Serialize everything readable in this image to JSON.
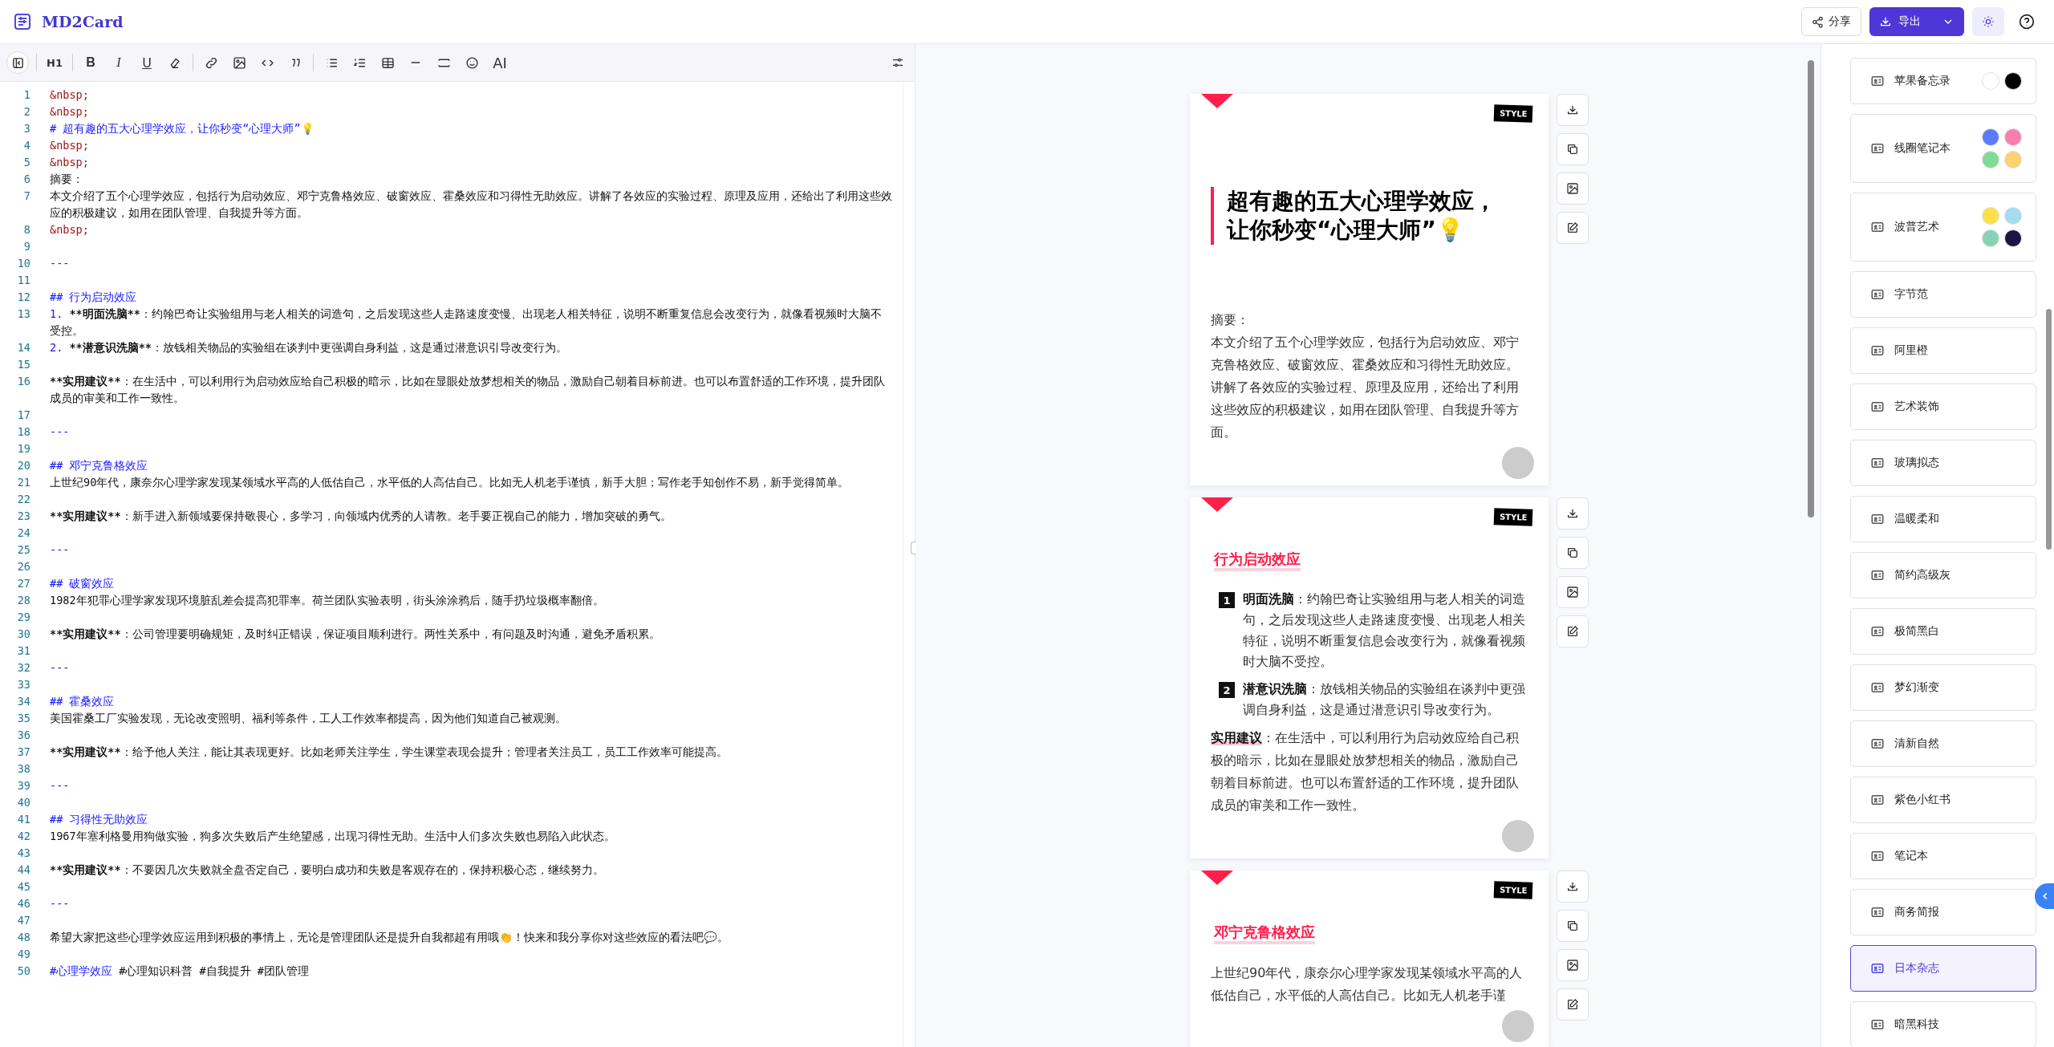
{
  "header": {
    "app_name": "MD2Card",
    "share_label": "分享",
    "export_label": "导出"
  },
  "toolbar": [
    {
      "kind": "sidebar-toggle"
    },
    {
      "kind": "sep"
    },
    {
      "kind": "heading",
      "label": "H1"
    },
    {
      "kind": "sep"
    },
    {
      "kind": "bold",
      "label": "B"
    },
    {
      "kind": "italic",
      "label": "I"
    },
    {
      "kind": "underline",
      "label": "U"
    },
    {
      "kind": "eraser"
    },
    {
      "kind": "sep"
    },
    {
      "kind": "link"
    },
    {
      "kind": "image"
    },
    {
      "kind": "code"
    },
    {
      "kind": "quote"
    },
    {
      "kind": "sep"
    },
    {
      "kind": "ul"
    },
    {
      "kind": "ol"
    },
    {
      "kind": "table"
    },
    {
      "kind": "hr"
    },
    {
      "kind": "block"
    },
    {
      "kind": "emoji"
    },
    {
      "kind": "ai",
      "label": "AI"
    }
  ],
  "editor_lines": [
    {
      "num": "1",
      "parts": [
        {
          "kind": "entity",
          "text": "&nbsp;"
        }
      ]
    },
    {
      "num": "2",
      "parts": [
        {
          "kind": "entity",
          "text": "&nbsp;"
        }
      ]
    },
    {
      "num": "3",
      "parts": [
        {
          "kind": "markup",
          "text": "# 超有趣的五大心理学效应，让你秒变“心理大师”💡"
        }
      ]
    },
    {
      "num": "4",
      "parts": [
        {
          "kind": "entity",
          "text": "&nbsp;"
        }
      ]
    },
    {
      "num": "5",
      "parts": [
        {
          "kind": "entity",
          "text": "&nbsp;"
        }
      ]
    },
    {
      "num": "6",
      "parts": [
        {
          "kind": "plain",
          "text": "摘要："
        }
      ]
    },
    {
      "num": "7",
      "parts": [
        {
          "kind": "plain",
          "text": "本文介绍了五个心理学效应，包括行为启动效应、邓宁克鲁格效应、破窗效应、霍桑效应和习得性无助效应。讲解了各效应的实验过程、原理及应用，还给出了利用这些效应的积极建议，如用在团队管理、自我提升等方面。"
        }
      ]
    },
    {
      "num": "8",
      "parts": [
        {
          "kind": "entity",
          "text": "&nbsp;"
        }
      ]
    },
    {
      "num": "9"
    },
    {
      "num": "10",
      "parts": [
        {
          "kind": "markup",
          "text": "---"
        }
      ]
    },
    {
      "num": "11"
    },
    {
      "num": "12",
      "parts": [
        {
          "kind": "markup",
          "text": "## 行为启动效应"
        }
      ]
    },
    {
      "num": "13",
      "parts": [
        {
          "kind": "markup",
          "text": "1. "
        },
        {
          "kind": "strong",
          "text": "**明面洗脑**"
        },
        {
          "kind": "plain",
          "text": "：约翰巴奇让实验组用与老人相关的词造句，之后发现这些人走路速度变慢、出现老人相关特征，说明不断重复信息会改变行为，就像看视频时大脑不受控。"
        }
      ]
    },
    {
      "num": "14",
      "parts": [
        {
          "kind": "markup",
          "text": "2. "
        },
        {
          "kind": "strong",
          "text": "**潜意识洗脑**"
        },
        {
          "kind": "plain",
          "text": "：放钱相关物品的实验组在谈判中更强调自身利益，这是通过潜意识引导改变行为。"
        }
      ]
    },
    {
      "num": "15"
    },
    {
      "num": "16",
      "parts": [
        {
          "kind": "strong",
          "text": "**实用建议**"
        },
        {
          "kind": "plain",
          "text": "：在生活中，可以利用行为启动效应给自己积极的暗示，比如在显眼处放梦想相关的物品，激励自己朝着目标前进。也可以布置舒适的工作环境，提升团队成员的审美和工作一致性。"
        }
      ]
    },
    {
      "num": "17"
    },
    {
      "num": "18",
      "parts": [
        {
          "kind": "markup",
          "text": "---"
        }
      ]
    },
    {
      "num": "19"
    },
    {
      "num": "20",
      "parts": [
        {
          "kind": "markup",
          "text": "## 邓宁克鲁格效应"
        }
      ]
    },
    {
      "num": "21",
      "parts": [
        {
          "kind": "plain",
          "text": "上世纪90年代，康奈尔心理学家发现某领域水平高的人低估自己，水平低的人高估自己。比如无人机老手谨慎，新手大胆；写作老手知创作不易，新手觉得简单。"
        }
      ]
    },
    {
      "num": "22"
    },
    {
      "num": "23",
      "parts": [
        {
          "kind": "strong",
          "text": "**实用建议**"
        },
        {
          "kind": "plain",
          "text": "：新手进入新领域要保持敬畏心，多学习，向领域内优秀的人请教。老手要正视自己的能力，增加突破的勇气。"
        }
      ]
    },
    {
      "num": "24"
    },
    {
      "num": "25",
      "parts": [
        {
          "kind": "markup",
          "text": "---"
        }
      ]
    },
    {
      "num": "26"
    },
    {
      "num": "27",
      "parts": [
        {
          "kind": "markup",
          "text": "## 破窗效应"
        }
      ]
    },
    {
      "num": "28",
      "parts": [
        {
          "kind": "plain",
          "text": "1982年犯罪心理学家发现环境脏乱差会提高犯罪率。荷兰团队实验表明，街头涂涂鸦后，随手扔垃圾概率翻倍。"
        }
      ]
    },
    {
      "num": "29"
    },
    {
      "num": "30",
      "parts": [
        {
          "kind": "strong",
          "text": "**实用建议**"
        },
        {
          "kind": "plain",
          "text": "：公司管理要明确规矩，及时纠正错误，保证项目顺利进行。两性关系中，有问题及时沟通，避免矛盾积累。"
        }
      ]
    },
    {
      "num": "31"
    },
    {
      "num": "32",
      "parts": [
        {
          "kind": "markup",
          "text": "---"
        }
      ]
    },
    {
      "num": "33"
    },
    {
      "num": "34",
      "parts": [
        {
          "kind": "markup",
          "text": "## 霍桑效应"
        }
      ]
    },
    {
      "num": "35",
      "parts": [
        {
          "kind": "plain",
          "text": "美国霍桑工厂实验发现，无论改变照明、福利等条件，工人工作效率都提高，因为他们知道自己被观测。"
        }
      ]
    },
    {
      "num": "36"
    },
    {
      "num": "37",
      "parts": [
        {
          "kind": "strong",
          "text": "**实用建议**"
        },
        {
          "kind": "plain",
          "text": "：给予他人关注，能让其表现更好。比如老师关注学生，学生课堂表现会提升；管理者关注员工，员工工作效率可能提高。"
        }
      ]
    },
    {
      "num": "38"
    },
    {
      "num": "39",
      "parts": [
        {
          "kind": "markup",
          "text": "---"
        }
      ]
    },
    {
      "num": "40"
    },
    {
      "num": "41",
      "parts": [
        {
          "kind": "markup",
          "text": "## 习得性无助效应"
        }
      ]
    },
    {
      "num": "42",
      "parts": [
        {
          "kind": "plain",
          "text": "1967年塞利格曼用狗做实验，狗多次失败后产生绝望感，出现习得性无助。生活中人们多次失败也易陷入此状态。"
        }
      ]
    },
    {
      "num": "43"
    },
    {
      "num": "44",
      "parts": [
        {
          "kind": "strong",
          "text": "**实用建议**"
        },
        {
          "kind": "plain",
          "text": "：不要因几次失败就全盘否定自己，要明白成功和失败是客观存在的，保持积极心态，继续努力。"
        }
      ]
    },
    {
      "num": "45"
    },
    {
      "num": "46",
      "parts": [
        {
          "kind": "markup",
          "text": "---"
        }
      ]
    },
    {
      "num": "47"
    },
    {
      "num": "48",
      "parts": [
        {
          "kind": "plain",
          "text": "希望大家把这些心理学效应运用到积极的事情上，无论是管理团队还是提升自我都超有用哦👏！快来和我分享你对这些效应的看法吧💬。"
        }
      ]
    },
    {
      "num": "49"
    },
    {
      "num": "50",
      "parts": [
        {
          "kind": "markup",
          "text": "#心理学效应"
        },
        {
          "kind": "plain",
          "text": " #心理知识科普 #自我提升 #团队管理"
        }
      ]
    }
  ],
  "cards": [
    {
      "badge": "STYLE",
      "blocks": [
        {
          "kind": "title",
          "text": "超有趣的五大心理学效应，让你秒变“心理大师”💡"
        },
        {
          "kind": "para",
          "text": "摘要："
        },
        {
          "kind": "para",
          "text": "本文介绍了五个心理学效应，包括行为启动效应、邓宁克鲁格效应、破窗效应、霍桑效应和习得性无助效应。讲解了各效应的实验过程、原理及应用，还给出了利用这些效应的积极建议，如用在团队管理、自我提升等方面。"
        }
      ]
    },
    {
      "badge": "STYLE",
      "blocks": [
        {
          "kind": "heading",
          "text": "行为启动效应"
        },
        {
          "kind": "item",
          "number": "1",
          "lead": "明面洗脑",
          "text": "：约翰巴奇让实验组用与老人相关的词造句，之后发现这些人走路速度变慢、出现老人相关特征，说明不断重复信息会改变行为，就像看视频时大脑不受控。"
        },
        {
          "kind": "item",
          "number": "2",
          "lead": "潜意识洗脑",
          "text": "：放钱相关物品的实验组在谈判中更强调自身利益，这是通过潜意识引导改变行为。"
        },
        {
          "kind": "tip",
          "lead": "实用建议",
          "text": "：在生活中，可以利用行为启动效应给自己积极的暗示，比如在显眼处放梦想相关的物品，激励自己朝着目标前进。也可以布置舒适的工作环境，提升团队成员的审美和工作一致性。"
        }
      ]
    },
    {
      "badge": "STYLE",
      "blocks": [
        {
          "kind": "heading",
          "text": "邓宁克鲁格效应"
        },
        {
          "kind": "para",
          "text": "上世纪90年代，康奈尔心理学家发现某领域水平高的人低估自己，水平低的人高估自己。比如无人机老手谨"
        }
      ]
    }
  ],
  "themes": [
    {
      "name": "苹果备忘录",
      "selected": false,
      "swatches": [
        {
          "color": "#ffffff"
        },
        {
          "color": "#000000"
        }
      ]
    },
    {
      "name": "线圈笔记本",
      "selected": false,
      "swatches": [
        {
          "color": "#5b7cfa"
        },
        {
          "color": "#f77fb0"
        },
        {
          "color": "#7fdc94"
        },
        {
          "color": "#fcd170"
        }
      ]
    },
    {
      "name": "波普艺术",
      "selected": false,
      "swatches": [
        {
          "color": "#fde047"
        },
        {
          "color": "#a5dcf0"
        },
        {
          "color": "#86d3b3"
        },
        {
          "color": "#1e1541"
        }
      ]
    },
    {
      "name": "字节范",
      "selected": false
    },
    {
      "name": "阿里橙",
      "selected": false
    },
    {
      "name": "艺术装饰",
      "selected": false
    },
    {
      "name": "玻璃拟态",
      "selected": false
    },
    {
      "name": "温暖柔和",
      "selected": false
    },
    {
      "name": "简约高级灰",
      "selected": false
    },
    {
      "name": "极简黑白",
      "selected": false
    },
    {
      "name": "梦幻渐变",
      "selected": false
    },
    {
      "name": "清新自然",
      "selected": false
    },
    {
      "name": "紫色小红书",
      "selected": false
    },
    {
      "name": "笔记本",
      "selected": false
    },
    {
      "name": "商务简报",
      "selected": false
    },
    {
      "name": "日本杂志",
      "selected": true
    },
    {
      "name": "暗黑科技",
      "selected": false
    }
  ]
}
